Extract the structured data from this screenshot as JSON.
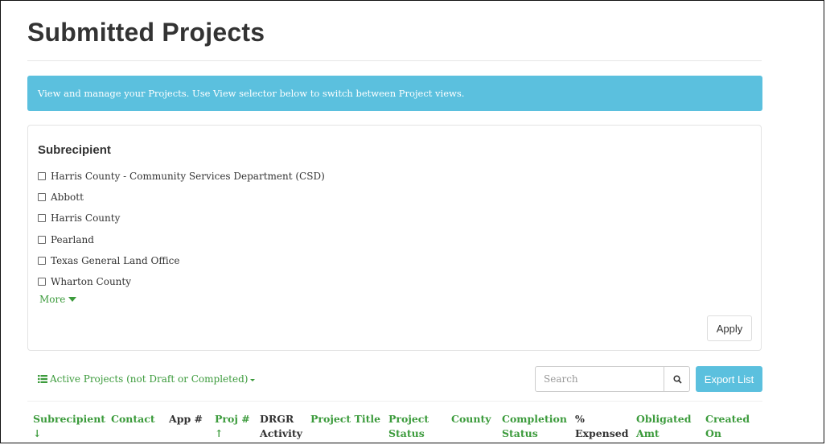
{
  "page": {
    "title": "Submitted Projects",
    "info_message": "View and manage your Projects. Use View selector below to switch between Project views."
  },
  "filter": {
    "heading": "Subrecipient",
    "subrecipients": [
      "Harris County - Community Services Department (CSD)",
      "Abbott",
      "Harris County",
      "Pearland",
      "Texas General Land Office",
      "Wharton County"
    ],
    "more_label": "More",
    "apply_label": "Apply"
  },
  "toolbar": {
    "view_selector_label": "Active Projects (not Draft or Completed)",
    "search_placeholder": "Search",
    "export_label": "Export List"
  },
  "table": {
    "columns": [
      {
        "line1": "Subrecipient",
        "line2": "↓"
      },
      {
        "line1": "",
        "line2": "Contact"
      },
      {
        "line1": "",
        "line2": "App #"
      },
      {
        "line1": "Proj #",
        "line2": "↑"
      },
      {
        "line1": "DRGR",
        "line2": "Activity"
      },
      {
        "line1": "",
        "line2": "Project Title"
      },
      {
        "line1": "Project",
        "line2": "Status"
      },
      {
        "line1": "",
        "line2": "County"
      },
      {
        "line1": "Completion",
        "line2": "Status"
      },
      {
        "line1": "%",
        "line2": "Expensed"
      },
      {
        "line1": "Obligated",
        "line2": "Amt"
      },
      {
        "line1": "Created",
        "line2": "On"
      }
    ]
  },
  "colors": {
    "accent_green": "#3c9b3c",
    "info_blue": "#5bc0de",
    "text_dark": "#333333"
  }
}
